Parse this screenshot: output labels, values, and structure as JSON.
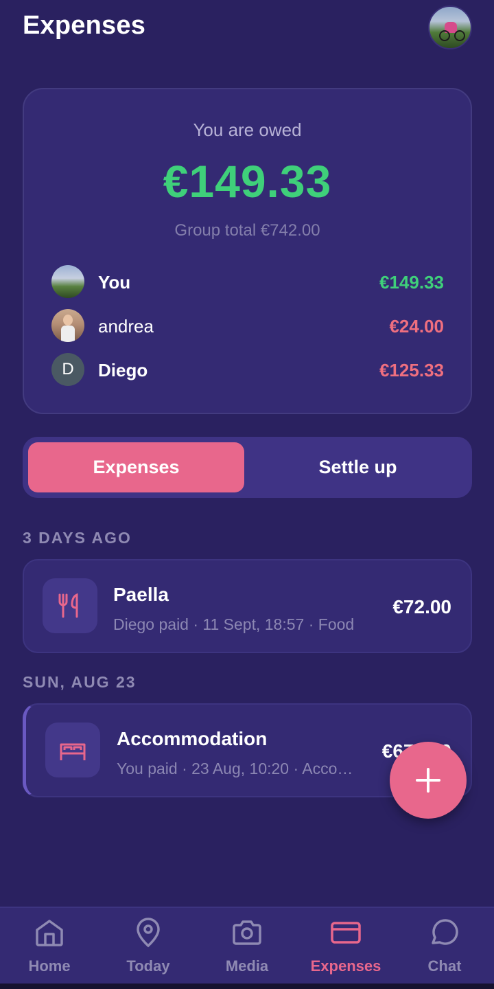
{
  "header": {
    "title": "Expenses",
    "avatar_icon": "profile-avatar-cyclist"
  },
  "summary": {
    "owed_label": "You are owed",
    "owed_amount": "€149.33",
    "group_total": "Group total €742.00",
    "members": [
      {
        "name": "You",
        "amount": "€149.33",
        "amount_color": "#3fd07a"
      },
      {
        "name": "andrea",
        "amount": "€24.00",
        "amount_color": "#ef6f7f"
      },
      {
        "name": "Diego",
        "initial": "D",
        "amount": "€125.33",
        "amount_color": "#ef6f7f"
      }
    ]
  },
  "tabs": {
    "expenses": "Expenses",
    "settle_up": "Settle up",
    "active": "expenses"
  },
  "sections": [
    {
      "label": "3 DAYS AGO",
      "items": [
        {
          "title": "Paella",
          "meta": "Diego paid · 11 Sept, 18:57 · Food",
          "amount": "€72.00",
          "icon": "fork-knife-icon"
        }
      ]
    },
    {
      "label": "SUN, AUG 23",
      "items": [
        {
          "title": "Accommodation",
          "meta": "You paid · 23 Aug, 10:20 · Acco…",
          "amount": "€670.00",
          "icon": "bed-icon"
        }
      ]
    }
  ],
  "fab": {
    "icon": "plus-icon"
  },
  "nav": [
    {
      "label": "Home",
      "icon": "home-icon"
    },
    {
      "label": "Today",
      "icon": "location-pin-icon"
    },
    {
      "label": "Media",
      "icon": "camera-icon"
    },
    {
      "label": "Expenses",
      "icon": "card-icon",
      "active": true
    },
    {
      "label": "Chat",
      "icon": "chat-bubble-icon"
    }
  ],
  "colors": {
    "background": "#2a2160",
    "card": "#342a73",
    "accent_pink": "#e8678c",
    "positive_green": "#3fd07a",
    "negative_red": "#ef6f7f"
  }
}
